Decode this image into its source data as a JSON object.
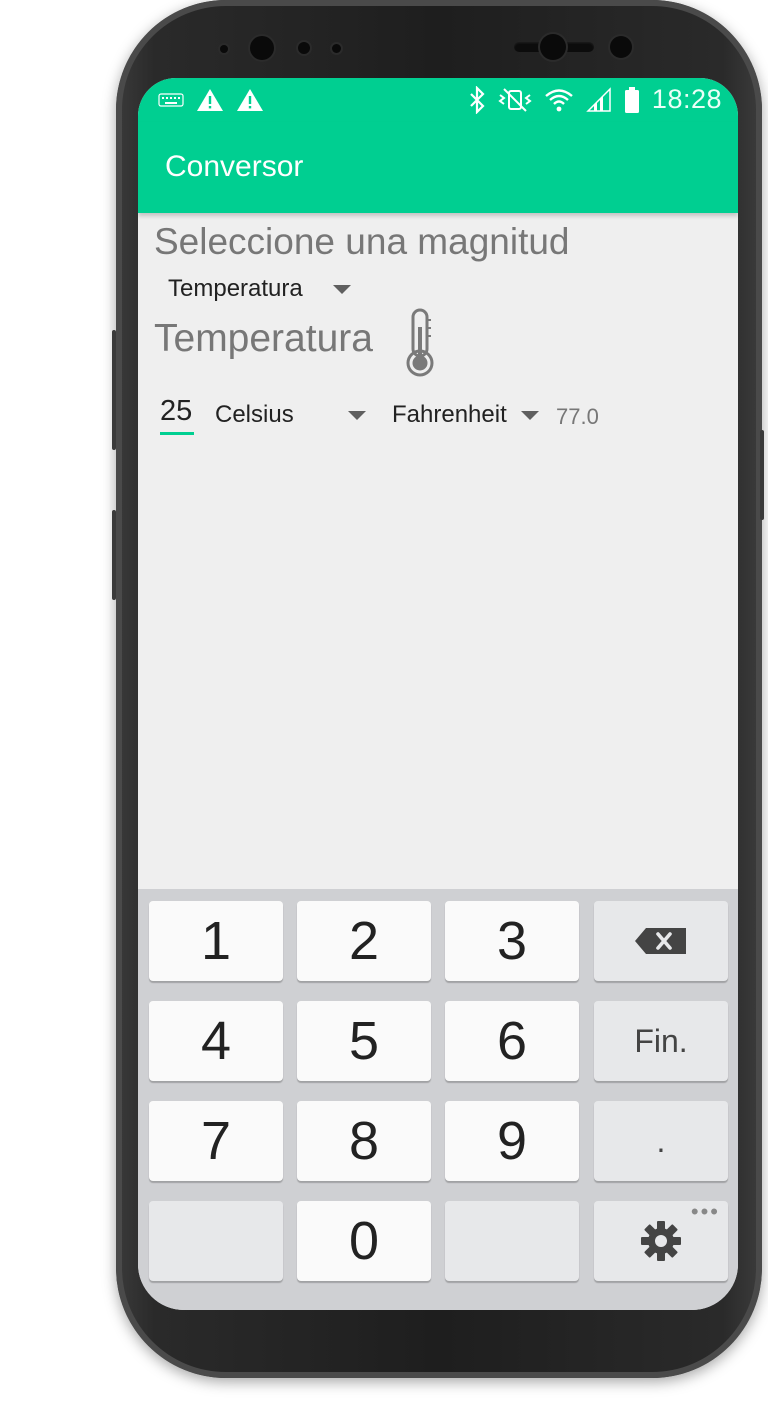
{
  "colors": {
    "accent": "#00cf91",
    "text_primary": "#222222",
    "text_secondary": "#777777",
    "keyboard_bg": "#cfd0d3"
  },
  "statusbar": {
    "left_icons": [
      "keyboard-icon",
      "warning-icon",
      "warning-icon"
    ],
    "right_icons": [
      "bluetooth-icon",
      "vibrate-icon",
      "wifi-icon",
      "signal-icon",
      "battery-icon"
    ],
    "time": "18:28"
  },
  "appbar": {
    "title": "Conversor"
  },
  "main": {
    "magnitude_prompt": "Seleccione una magnitud",
    "magnitude_select": "Temperatura",
    "section_title": "Temperatura",
    "section_icon": "thermometer-icon",
    "input_value": "25",
    "from_unit": "Celsius",
    "to_unit": "Fahrenheit",
    "result": "77.0"
  },
  "keyboard": {
    "rows": [
      [
        "1",
        "2",
        "3",
        "backspace"
      ],
      [
        "4",
        "5",
        "6",
        "Fin."
      ],
      [
        "7",
        "8",
        "9",
        "."
      ],
      [
        "",
        "0",
        "",
        "settings"
      ]
    ],
    "labels": {
      "k1": "1",
      "k2": "2",
      "k3": "3",
      "k4": "4",
      "k5": "5",
      "k6": "6",
      "k7": "7",
      "k8": "8",
      "k9": "9",
      "k0": "0",
      "fin": "Fin.",
      "dot": ".",
      "more": "•••"
    }
  }
}
